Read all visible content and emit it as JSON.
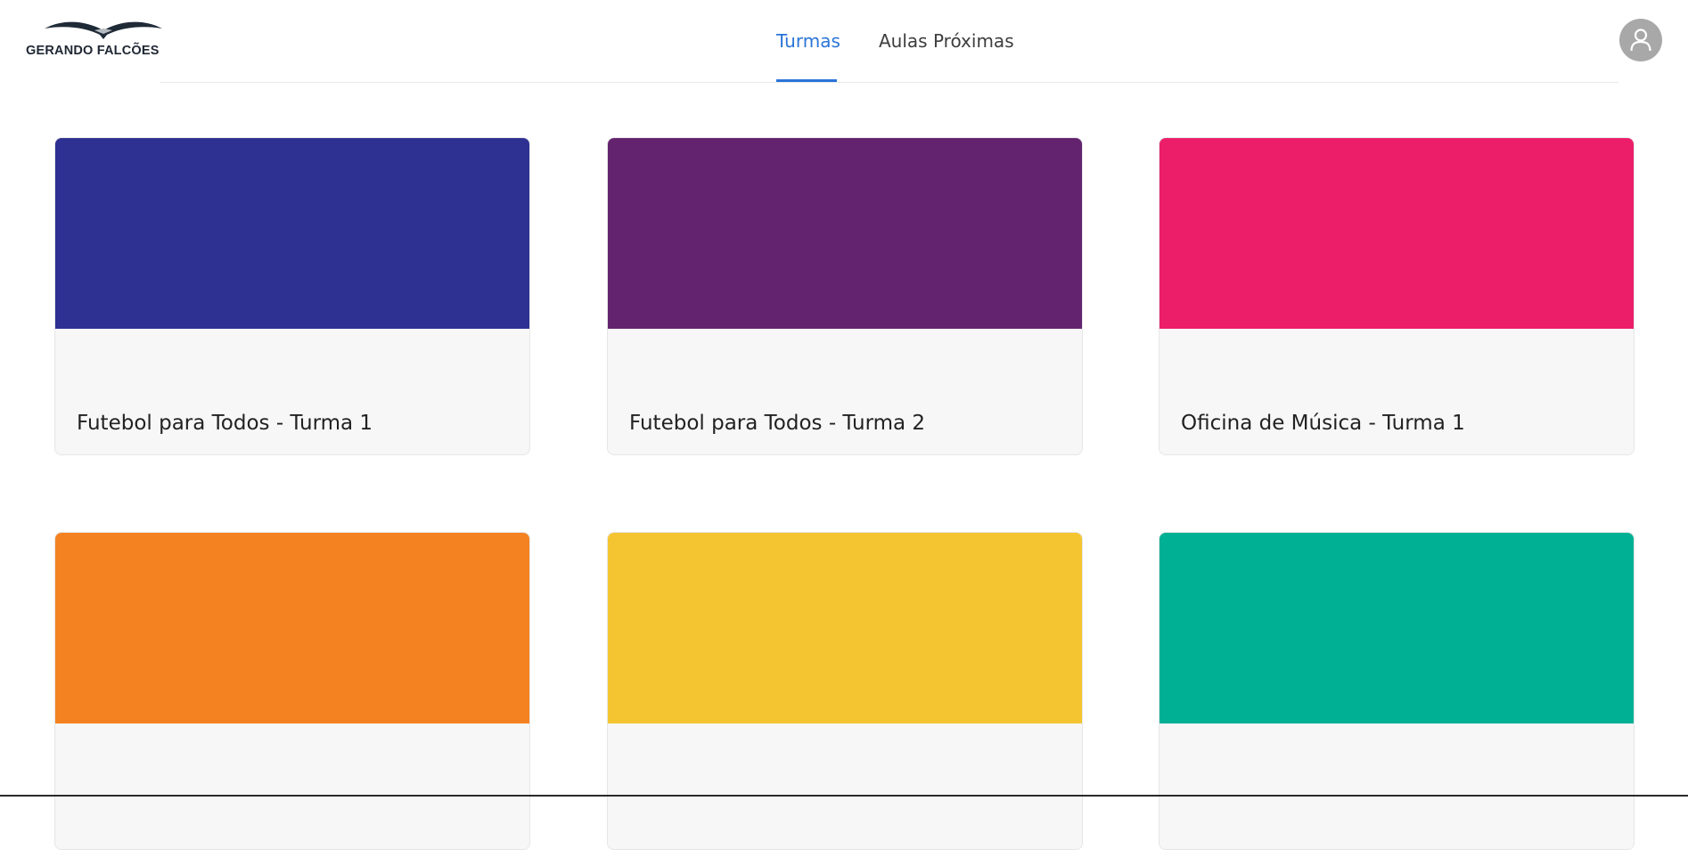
{
  "brand": {
    "logo_text": "GERANDO FALCÕES"
  },
  "nav": {
    "tabs": [
      {
        "label": "Turmas",
        "active": true
      },
      {
        "label": "Aulas Próximas",
        "active": false
      }
    ]
  },
  "user": {
    "avatar_icon": "user-icon"
  },
  "classes": [
    {
      "title": "Futebol para Todos - Turma 1",
      "color": "#2e3192"
    },
    {
      "title": "Futebol para Todos - Turma 2",
      "color": "#63236e"
    },
    {
      "title": "Oficina de Música - Turma 1",
      "color": "#ec1e6a"
    },
    {
      "title": "",
      "color": "#f58220"
    },
    {
      "title": "",
      "color": "#f4c531"
    },
    {
      "title": "",
      "color": "#00b094"
    }
  ],
  "colors": {
    "accent": "#2a74d8",
    "card_body": "#f7f7f7"
  }
}
